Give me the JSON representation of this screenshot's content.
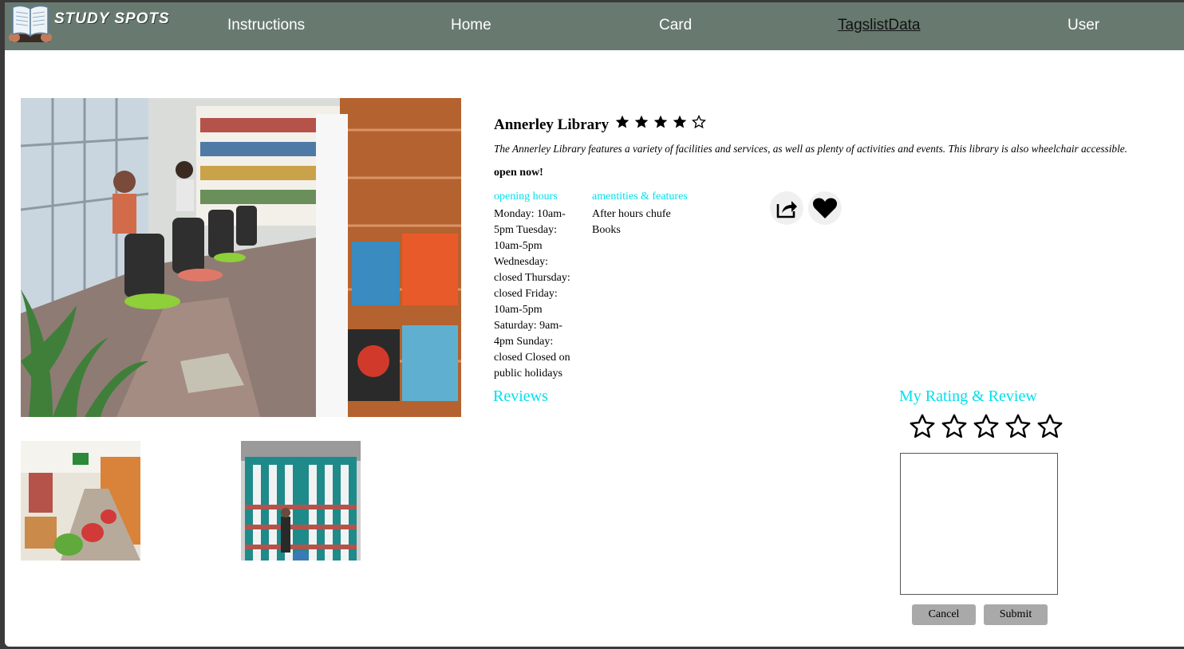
{
  "header": {
    "logo_text": "STUDY SPOTS",
    "nav": [
      {
        "label": "Instructions"
      },
      {
        "label": "Home"
      },
      {
        "label": "Card"
      },
      {
        "label": "TagslistData"
      },
      {
        "label": "User"
      }
    ],
    "active_nav": "TagslistData",
    "background_color": "#687a70"
  },
  "library": {
    "name": "Annerley Library",
    "rating": 4,
    "rating_max": 5,
    "description": "The Annerley Library features a variety of facilities and services, as well as plenty of activities and events. This library is also wheelchair accessible.",
    "status": "open now!",
    "opening_hours_label": "opening hours",
    "opening_hours": "Monday: 10am-5pm Tuesday: 10am-5pm Wednesday: closed Thursday: closed Friday: 10am-5pm Saturday: 9am-4pm Sunday: closed Closed on public holidays",
    "features_label": "amentities & features",
    "features": [
      "After hours chufe",
      "Books"
    ],
    "share_icon": "share-icon",
    "favorite_icon": "heart-icon"
  },
  "reviews": {
    "heading": "Reviews"
  },
  "my_review": {
    "heading": "My Rating & Review",
    "rating": 0,
    "rating_max": 5,
    "review_text": "",
    "cancel_label": "Cancel",
    "submit_label": "Submit"
  },
  "colors": {
    "accent": "#00e0ee",
    "button": "#a9a9a9"
  }
}
